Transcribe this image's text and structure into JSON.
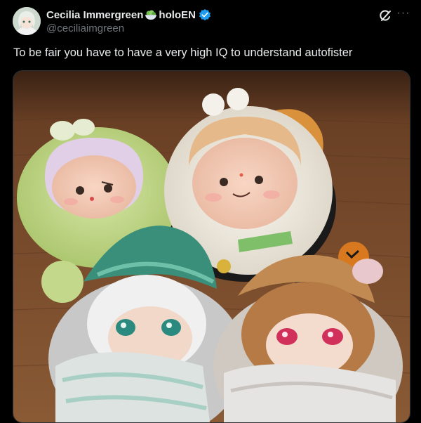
{
  "author": {
    "display_name": "Cecilia Immergreen",
    "name_suffix": "holoEN",
    "handle": "@ceciliaimgreen",
    "emoji_icon": "salad-bowl-icon",
    "verified_icon": "verified-badge-icon"
  },
  "actions": {
    "grok_icon": "grok-icon",
    "more_icon": "more-options-icon",
    "more_glyph": "···"
  },
  "tweet": {
    "text": "To be fair you have to have a very high IQ to understand autofister"
  },
  "media": {
    "type": "photo",
    "subject": "plush-dolls-photo"
  },
  "colors": {
    "background": "#000000",
    "text": "#e7e9ea",
    "secondary_text": "#71767b",
    "verified": "#1d9bf0",
    "border": "#2f3336"
  }
}
